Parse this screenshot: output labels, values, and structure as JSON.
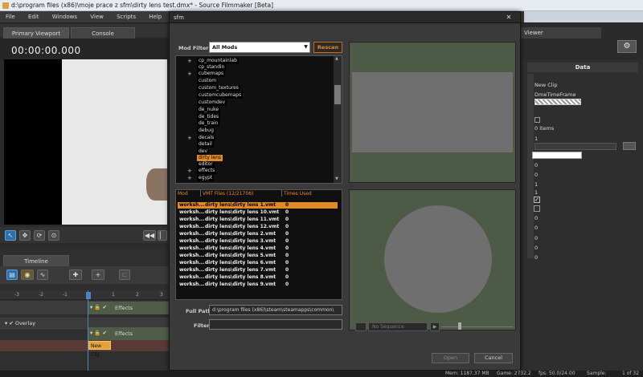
{
  "window": {
    "title": "d:\\program files (x86)\\moje prace z sfm\\dirty lens test.dmx* - Source Filmmaker [Beta]"
  },
  "menu": [
    "File",
    "Edit",
    "Windows",
    "View",
    "Scripts",
    "Help"
  ],
  "viewport": {
    "tabs": [
      "Primary Viewport",
      "Console"
    ],
    "timecode": "00:00:00.000"
  },
  "timeline": {
    "tab": "Timeline",
    "ruler": [
      "-3",
      "-2",
      "-1",
      "0",
      "1",
      "2",
      "3"
    ],
    "tracks": {
      "effects1": "Effects",
      "overlay": "Overlay",
      "effects2": "Effects"
    },
    "clip": "New Clip"
  },
  "right_panel": {
    "tab": "Viewer",
    "header": "Data",
    "items": [
      "New Clip",
      "DmeTimeFrame",
      "0 items",
      "1",
      "0",
      "0",
      "1",
      "1",
      "0",
      "0",
      "0",
      "0",
      "0",
      "0",
      "0"
    ],
    "page": "1 of 32"
  },
  "dialog": {
    "title": "sfm",
    "mod_filter_label": "Mod Filter",
    "mod_filter_value": "All Mods",
    "rescan": "Rescan",
    "tree": [
      {
        "label": "cp_mountainlab",
        "expand": true
      },
      {
        "label": "cp_standin",
        "expand": false
      },
      {
        "label": "cubemaps",
        "expand": true
      },
      {
        "label": "custom",
        "expand": false
      },
      {
        "label": "custom_textures",
        "expand": false
      },
      {
        "label": "customcubemaps",
        "expand": false
      },
      {
        "label": "customdev",
        "expand": false
      },
      {
        "label": "de_nuke",
        "expand": false
      },
      {
        "label": "de_tides",
        "expand": false
      },
      {
        "label": "de_train",
        "expand": false
      },
      {
        "label": "debug",
        "expand": false
      },
      {
        "label": "decals",
        "expand": true
      },
      {
        "label": "detail",
        "expand": false
      },
      {
        "label": "dev",
        "expand": false
      },
      {
        "label": "dirty lens",
        "expand": false,
        "selected": true
      },
      {
        "label": "editor",
        "expand": false
      },
      {
        "label": "effects",
        "expand": true
      },
      {
        "label": "egypt",
        "expand": true
      }
    ],
    "list_headers": {
      "mod": "Mod",
      "files": "VMT Files (12/21706)",
      "times": "Times Used"
    },
    "rows": [
      {
        "mod": "worksh...",
        "file": "dirty lens\\dirty lens 1.vmt",
        "times": "0"
      },
      {
        "mod": "worksh...",
        "file": "dirty lens\\dirty lens 10.vmt",
        "times": "0"
      },
      {
        "mod": "worksh...",
        "file": "dirty lens\\dirty lens 11.vmt",
        "times": "0"
      },
      {
        "mod": "worksh...",
        "file": "dirty lens\\dirty lens 12.vmt",
        "times": "0"
      },
      {
        "mod": "worksh...",
        "file": "dirty lens\\dirty lens 2.vmt",
        "times": "0"
      },
      {
        "mod": "worksh...",
        "file": "dirty lens\\dirty lens 3.vmt",
        "times": "0"
      },
      {
        "mod": "worksh...",
        "file": "dirty lens\\dirty lens 4.vmt",
        "times": "0"
      },
      {
        "mod": "worksh...",
        "file": "dirty lens\\dirty lens 5.vmt",
        "times": "0"
      },
      {
        "mod": "worksh...",
        "file": "dirty lens\\dirty lens 6.vmt",
        "times": "0"
      },
      {
        "mod": "worksh...",
        "file": "dirty lens\\dirty lens 7.vmt",
        "times": "0"
      },
      {
        "mod": "worksh...",
        "file": "dirty lens\\dirty lens 8.vmt",
        "times": "0"
      },
      {
        "mod": "worksh...",
        "file": "dirty lens\\dirty lens 9.vmt",
        "times": "0"
      }
    ],
    "full_path_label": "Full Path",
    "full_path_value": "d:\\program files (x86)\\steam\\steamapps\\common\\",
    "filter_label": "Filter",
    "sequence_label": "No Sequence",
    "open": "Open",
    "cancel": "Cancel"
  },
  "status": {
    "mem": "Mem:  1187.37 MB",
    "game": "Game:  2732.2",
    "fps": "fps:  50.0/24.00",
    "sample": "Sample:"
  }
}
